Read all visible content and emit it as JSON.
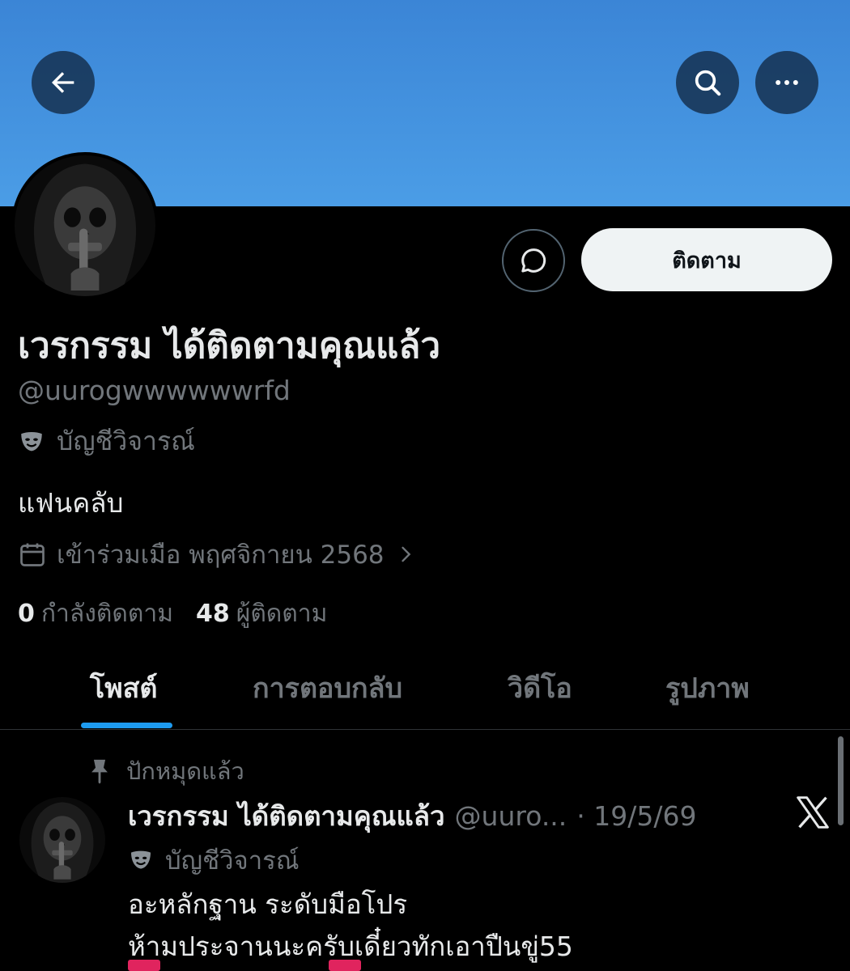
{
  "header": {
    "back_icon": "arrow-left-icon",
    "search_icon": "search-icon",
    "more_icon": "more-horizontal-icon"
  },
  "profile": {
    "display_name": "เวรกรรม ได้ติดตามคุณแล้ว",
    "handle": "@uurogwwwwwwrfd",
    "account_label": "บัญชีวิจารณ์",
    "bio": "แฟนคลับ",
    "joined": "เข้าร่วมเมือ พฤศจิกายน 2568",
    "following_count": "0",
    "following_label": "กำลังติดตาม",
    "followers_count": "48",
    "followers_label": "ผู้ติดตาม",
    "follow_button": "ติดตาม",
    "message_icon": "message-icon"
  },
  "tabs": [
    {
      "label": "โพสต์",
      "active": true
    },
    {
      "label": "การตอบกลับ",
      "active": false
    },
    {
      "label": "วิดีโอ",
      "active": false
    },
    {
      "label": "รูปภาพ",
      "active": false
    }
  ],
  "post": {
    "pinned_label": "ปักหมุดแล้ว",
    "author_name": "เวรกรรม ได้ติดตามคุณแล้ว",
    "author_handle": "@uuro...",
    "date": "· 19/5/69",
    "account_label": "บัญชีวิจารณ์",
    "text_line1": "อะหลักฐาน ระดับมือโปร",
    "text_line2": "ห้ามประจานนะครับเดี๋ยวทักเอาปืนขู่55"
  },
  "colors": {
    "banner": "#4b9de6",
    "accent": "#1d9bf0",
    "muted_text": "#71767b"
  }
}
